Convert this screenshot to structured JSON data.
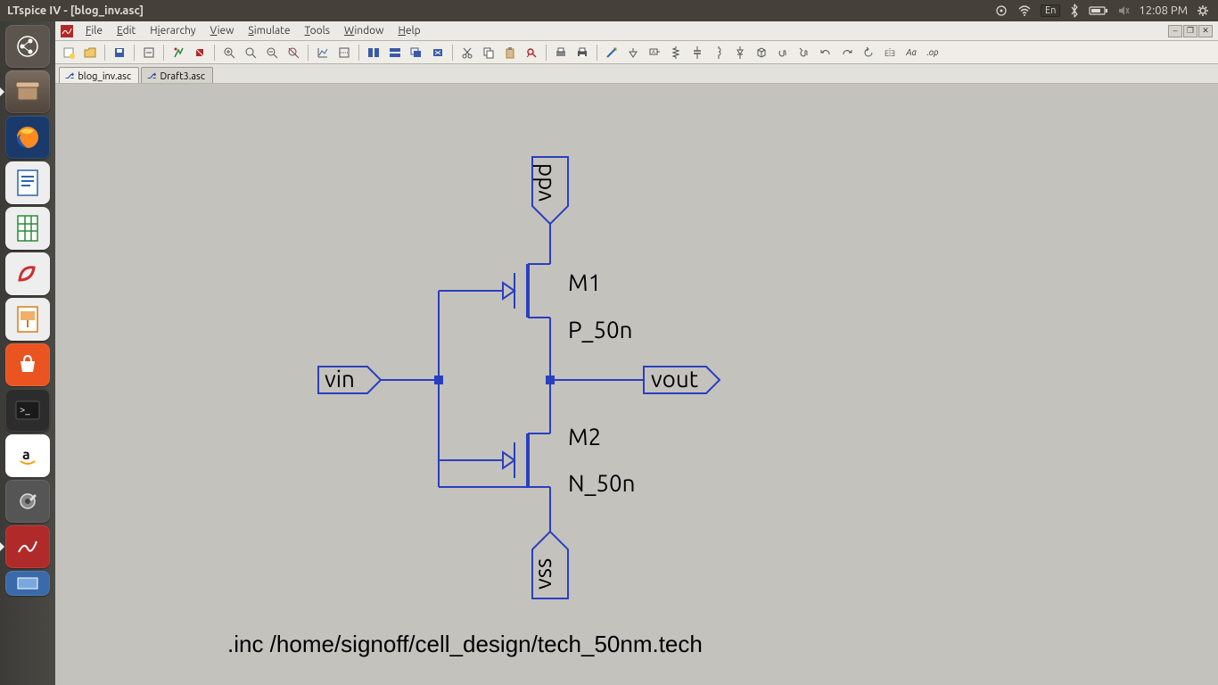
{
  "panel": {
    "title": "LTspice IV - [blog_inv.asc]",
    "lang": "En",
    "time": "12:08 PM"
  },
  "menus": {
    "file": "File",
    "edit": "Edit",
    "hierarchy": "Hierarchy",
    "view": "View",
    "simulate": "Simulate",
    "tools": "Tools",
    "window": "Window",
    "help": "Help"
  },
  "tabs": [
    {
      "label": "blog_inv.asc",
      "active": true
    },
    {
      "label": "Draft3.asc",
      "active": false
    }
  ],
  "schematic": {
    "ports": {
      "vdd": "vdd",
      "vss": "vss",
      "vin": "vin",
      "vout": "vout"
    },
    "devices": {
      "m1_name": "M1",
      "m1_model": "P_50n",
      "m2_name": "M2",
      "m2_model": "N_50n"
    },
    "directive": ".inc /home/signoff/cell_design/tech_50nm.tech"
  },
  "toolbar_text": {
    "aa": "Aa",
    "op": ".op"
  }
}
